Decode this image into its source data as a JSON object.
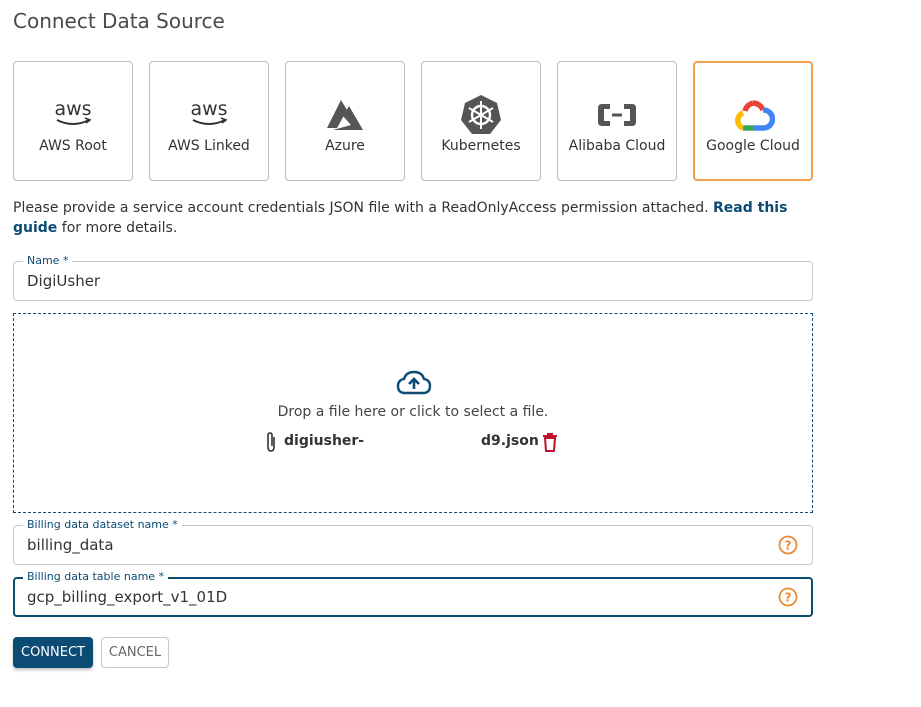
{
  "page": {
    "title": "Connect Data Source"
  },
  "providers": [
    {
      "label": "AWS Root",
      "icon": "aws-logo-icon",
      "logo_text": "aws",
      "selected": false
    },
    {
      "label": "AWS Linked",
      "icon": "aws-logo-icon",
      "logo_text": "aws",
      "selected": false
    },
    {
      "label": "Azure",
      "icon": "azure-logo-icon",
      "selected": false
    },
    {
      "label": "Kubernetes",
      "icon": "kubernetes-logo-icon",
      "selected": false
    },
    {
      "label": "Alibaba Cloud",
      "icon": "alibaba-cloud-logo-icon",
      "selected": false
    },
    {
      "label": "Google Cloud",
      "icon": "google-cloud-logo-icon",
      "selected": true
    }
  ],
  "description": {
    "text_before": "Please provide a service account credentials JSON file with a ReadOnlyAccess permission attached. ",
    "link": "Read this guide",
    "text_after": " for more details."
  },
  "name_field": {
    "label": "Name *",
    "value": "DigiUsher"
  },
  "dropzone": {
    "text": "Drop a file here or click to select a file.",
    "file_name_start": "digiusher-",
    "file_name_end": "d9.json"
  },
  "dataset_field": {
    "label": "Billing data dataset name *",
    "value": "billing_data",
    "icon": "help-icon"
  },
  "table_field": {
    "label": "Billing data table name *",
    "value": "gcp_billing_export_v1_01D",
    "icon": "help-icon"
  },
  "actions": {
    "connect": "CONNECT",
    "cancel": "CANCEL"
  },
  "colors": {
    "primary": "#0b4b74",
    "selected_border": "#f0a050",
    "help": "#e88a2e",
    "danger": "#c0112a"
  }
}
